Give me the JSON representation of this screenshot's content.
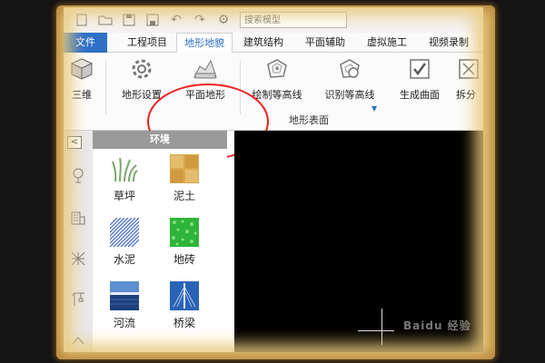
{
  "search": {
    "placeholder": "搜索模型"
  },
  "tabs": {
    "file": "文件",
    "items": [
      "工程项目",
      "地形地貌",
      "建筑结构",
      "平面辅助",
      "虚拟施工",
      "视频录制"
    ]
  },
  "ribbon": {
    "three_d": "三维",
    "terrain_settings": "地形设置",
    "flat_terrain": "平面地形",
    "draw_contours": "绘制等高线",
    "identify_contours": "识别等高线",
    "generate_surface": "生成曲面",
    "split": "拆分",
    "group_label": "地形表面"
  },
  "panel": {
    "title": "环境",
    "materials": [
      "草坪",
      "泥土",
      "水泥",
      "地砖",
      "河流",
      "桥梁"
    ]
  },
  "viewport": {
    "watermark": "Baidu 经验"
  },
  "colors": {
    "accent": "#2f6fc6",
    "highlight": "#e22222",
    "panel_header": "#9a9a9a"
  }
}
